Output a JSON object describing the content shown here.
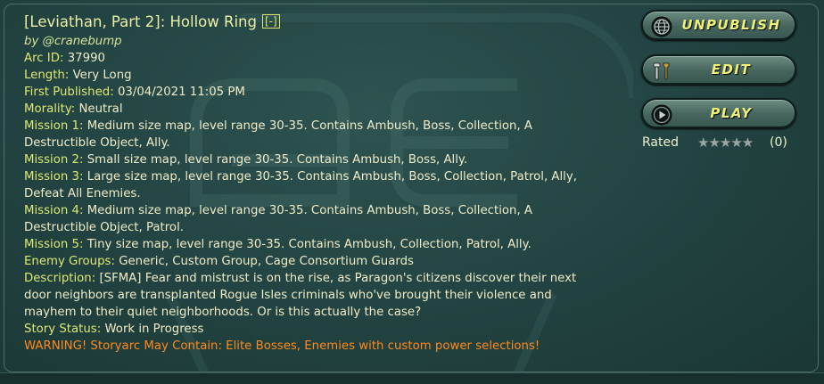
{
  "header": {
    "title": "[Leviathan, Part 2]: Hollow Ring",
    "collapse_label": "[-]",
    "author": "by @cranebump"
  },
  "details": [
    {
      "label": "Arc ID: ",
      "value": "37990"
    },
    {
      "label": "Length: ",
      "value": "Very Long"
    },
    {
      "label": "First Published: ",
      "value": "03/04/2021 11:05 PM"
    },
    {
      "label": "Morality: ",
      "value": "Neutral"
    },
    {
      "label": "Mission 1: ",
      "value": "Medium size map, level range 30-35. Contains Ambush, Boss, Collection, A Destructible Object, Ally."
    },
    {
      "label": "Mission 2: ",
      "value": "Small size map, level range 30-35. Contains Ambush, Boss, Ally."
    },
    {
      "label": "Mission 3: ",
      "value": "Large size map, level range 30-35. Contains Ambush, Boss, Collection, Patrol, Ally, Defeat All Enemies."
    },
    {
      "label": "Mission 4: ",
      "value": "Medium size map, level range 30-35. Contains Ambush, Boss, Collection, A Destructible Object, Patrol."
    },
    {
      "label": "Mission 5: ",
      "value": "Tiny size map, level range 30-35. Contains Ambush, Collection, Patrol, Ally."
    },
    {
      "label": "Enemy Groups: ",
      "value": "Generic, Custom Group, Cage Consortium Guards"
    },
    {
      "label": "Description: ",
      "value": "[SFMA] Fear and mistrust is on the rise, as Paragon's citizens discover their next door neighbors are transplanted Rogue Isles criminals who've brought their violence and mayhem to their quiet neighborhoods. Or is this actually the case?"
    },
    {
      "label": "Story Status: ",
      "value": "Work in Progress"
    }
  ],
  "warning": {
    "label": "WARNING! Storyarc May Contain: ",
    "value": "Elite Bosses, Enemies with custom power selections!"
  },
  "actions": {
    "unpublish_label": "UNPUBLISH",
    "edit_label": "EDIT",
    "play_label": "PLAY"
  },
  "rating": {
    "label": "Rated",
    "stars_display": "★★★★★",
    "stars_value": 0,
    "count": "(0)"
  },
  "icons": {
    "unpublish": "globe-icon",
    "edit": "tools-icon",
    "play": "play-icon"
  },
  "colors": {
    "panel_bg": "#234543",
    "label": "#dde873",
    "text": "#f0ecc8",
    "warning": "#ff8a1c",
    "button_text": "#eef07a"
  }
}
